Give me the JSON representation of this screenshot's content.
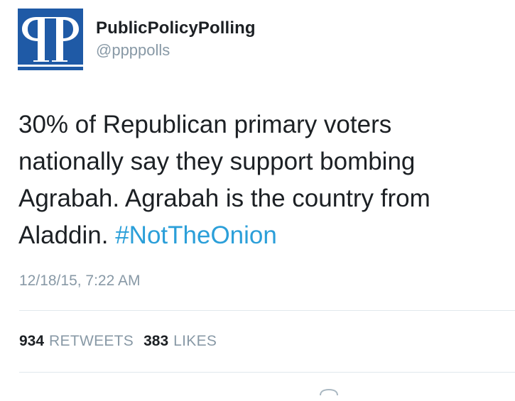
{
  "tweet": {
    "user": {
      "display_name": "PublicPolicyPolling",
      "handle": "@ppppolls",
      "avatar_icon": "ppp-logo-icon",
      "avatar_color": "#1f5aa6"
    },
    "text": "30% of Republican primary voters nationally say they support bombing Agrabah. Agrabah is the country from Aladdin. ",
    "hashtag": "#NotTheOnion",
    "hashtag_color": "#2b9fd9",
    "timestamp": "12/18/15, 7:22 AM",
    "stats": {
      "retweets_count": "934",
      "retweets_label": "RETWEETS",
      "likes_count": "383",
      "likes_label": "LIKES"
    }
  }
}
